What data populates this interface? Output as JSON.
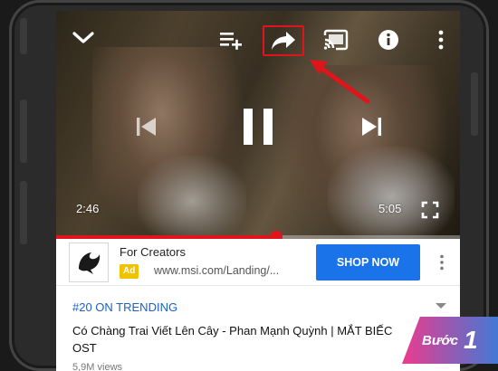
{
  "player": {
    "current_time": "2:46",
    "duration": "5:05",
    "progress_fraction": 0.545,
    "icons": [
      "chevron-down-icon",
      "add-to-queue-icon",
      "share-icon",
      "cast-icon",
      "info-icon",
      "more-vert-icon",
      "skip-previous-icon",
      "pause-icon",
      "skip-next-icon",
      "fullscreen-icon"
    ],
    "highlight_color": "#e0141b"
  },
  "ad": {
    "advertiser": "For Creators",
    "badge": "Ad",
    "url": "www.msi.com/Landing/...",
    "cta": "SHOP NOW",
    "cta_color": "#1a73e8",
    "logo": "msi-dragon-logo"
  },
  "video_info": {
    "trending": "#20 ON TRENDING",
    "title": "Có Chàng Trai Viết Lên Cây - Phan Mạnh Quỳnh | MẮT BIẾC OST",
    "views": "5,9M views"
  },
  "step": {
    "label": "Bước",
    "number": "1"
  }
}
